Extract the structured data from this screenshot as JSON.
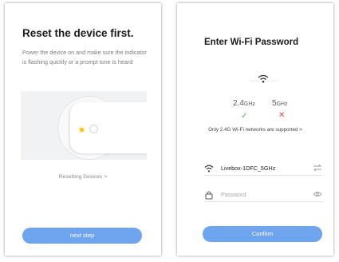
{
  "reset_screen": {
    "title": "Reset the device first.",
    "description": "Power the device on and make sure the indicator is flashing quickly or a prompt tone is heard",
    "resetting_link": "Resetting Devices",
    "resetting_chevron": ">",
    "next_button": "next step"
  },
  "wifi_screen": {
    "title": "Enter Wi-Fi Password",
    "bands": [
      {
        "label": "2.4",
        "unit": "GHz",
        "supported": true
      },
      {
        "label": "5",
        "unit": "GHz",
        "supported": false
      }
    ],
    "check_mark": "✓",
    "cross_mark": "✕",
    "note": "Only 2.4G Wi-Fi networks are supported >",
    "ssid_value": "Livebox-1DFC_5GHz",
    "password_placeholder": "Password",
    "password_value": "",
    "confirm_button": "Confirm"
  },
  "colors": {
    "accent": "#6fa5ef",
    "check": "#45b45e",
    "cross": "#e2433f",
    "led": "#f5c518"
  },
  "icons": {
    "wifi_graphic": "wifi-icon",
    "ssid_field": "wifi-icon",
    "ssid_trail": "switch-network-icon",
    "password_field": "lock-icon",
    "password_trail": "eye-icon"
  }
}
